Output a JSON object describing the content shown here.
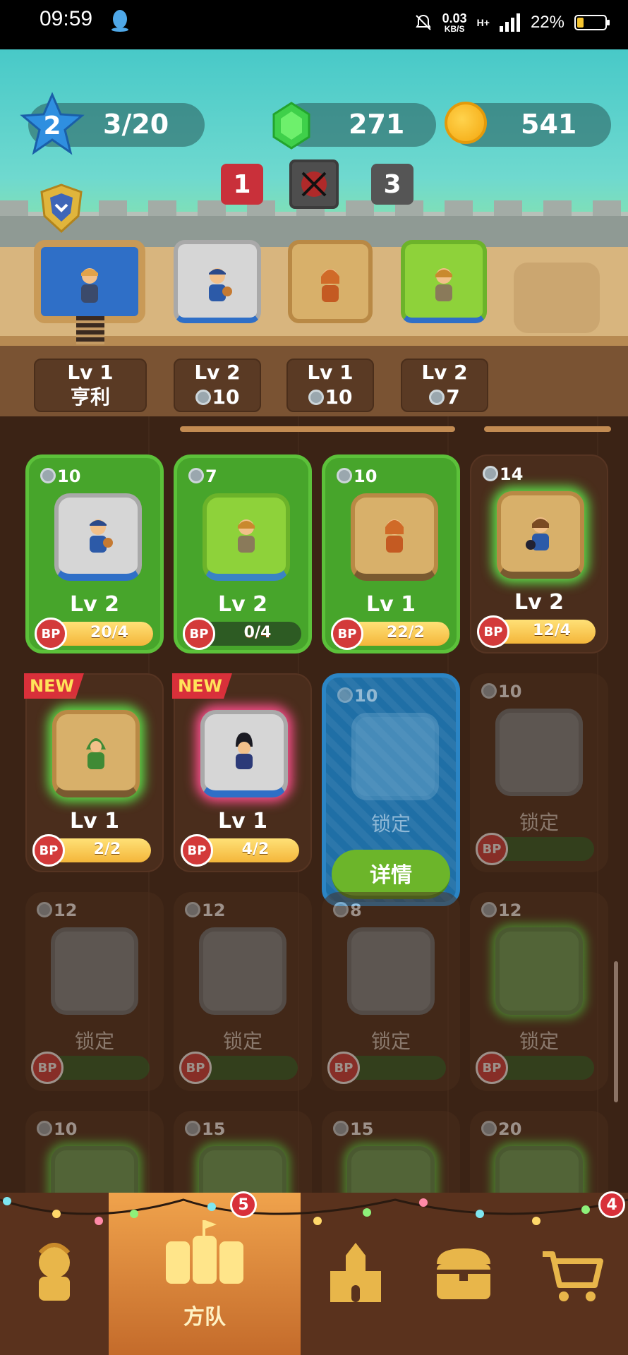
{
  "status_bar": {
    "time": "09:59",
    "speed_value": "0.03",
    "speed_unit": "KB/S",
    "network": "H+",
    "battery_percent": "22%",
    "battery_level": 0.22
  },
  "resources": {
    "level": "2",
    "xp": "3/20",
    "gems": "271",
    "coins": "541"
  },
  "stages": {
    "left": "1",
    "right": "3"
  },
  "formation_slots": [
    {
      "level": "Lv 1",
      "sub": "亨利",
      "has_coin": false
    },
    {
      "level": "Lv 2",
      "sub": "10",
      "has_coin": true
    },
    {
      "level": "Lv 1",
      "sub": "10",
      "has_coin": true
    },
    {
      "level": "Lv 2",
      "sub": "7",
      "has_coin": true
    }
  ],
  "cards": [
    {
      "cost": "10",
      "level": "Lv 2",
      "bp": "20/4",
      "bp_fill": 1.0,
      "style": "stone"
    },
    {
      "cost": "7",
      "level": "Lv 2",
      "bp": "0/4",
      "bp_fill": 0.0,
      "style": "grass"
    },
    {
      "cost": "10",
      "level": "Lv 1",
      "bp": "22/2",
      "bp_fill": 1.0,
      "style": "wood"
    },
    {
      "cost": "14",
      "level": "Lv 2",
      "bp": "12/4",
      "bp_fill": 1.0,
      "style": "wood"
    },
    {
      "tag": "NEW",
      "level": "Lv 1",
      "bp": "2/2",
      "bp_fill": 1.0
    },
    {
      "tag": "NEW",
      "level": "Lv 1",
      "bp": "4/2",
      "bp_fill": 1.0
    },
    {
      "cost": "10",
      "locked_label": "锁定",
      "button": "详情"
    },
    {
      "cost": "10",
      "locked_label": "锁定"
    },
    {
      "cost": "12",
      "locked_label": "锁定"
    },
    {
      "cost": "12",
      "locked_label": "锁定"
    },
    {
      "cost": "8",
      "locked_label": "锁定"
    },
    {
      "cost": "12",
      "locked_label": "锁定"
    },
    {
      "cost": "10"
    },
    {
      "cost": "15"
    },
    {
      "cost": "15"
    },
    {
      "cost": "20"
    }
  ],
  "bp_badge": "BP",
  "nav": {
    "items": [
      "hero-icon",
      "squad-icon",
      "castle-icon",
      "chest-icon",
      "cart-icon"
    ],
    "active_label": "方队",
    "squad_badge": "5",
    "shop_badge": "4"
  },
  "colors": {
    "active_card": "#47a52b",
    "selected_card": "#1f6fa6",
    "bp_bar": "#f4b63a",
    "stage_red": "#c9303a"
  }
}
